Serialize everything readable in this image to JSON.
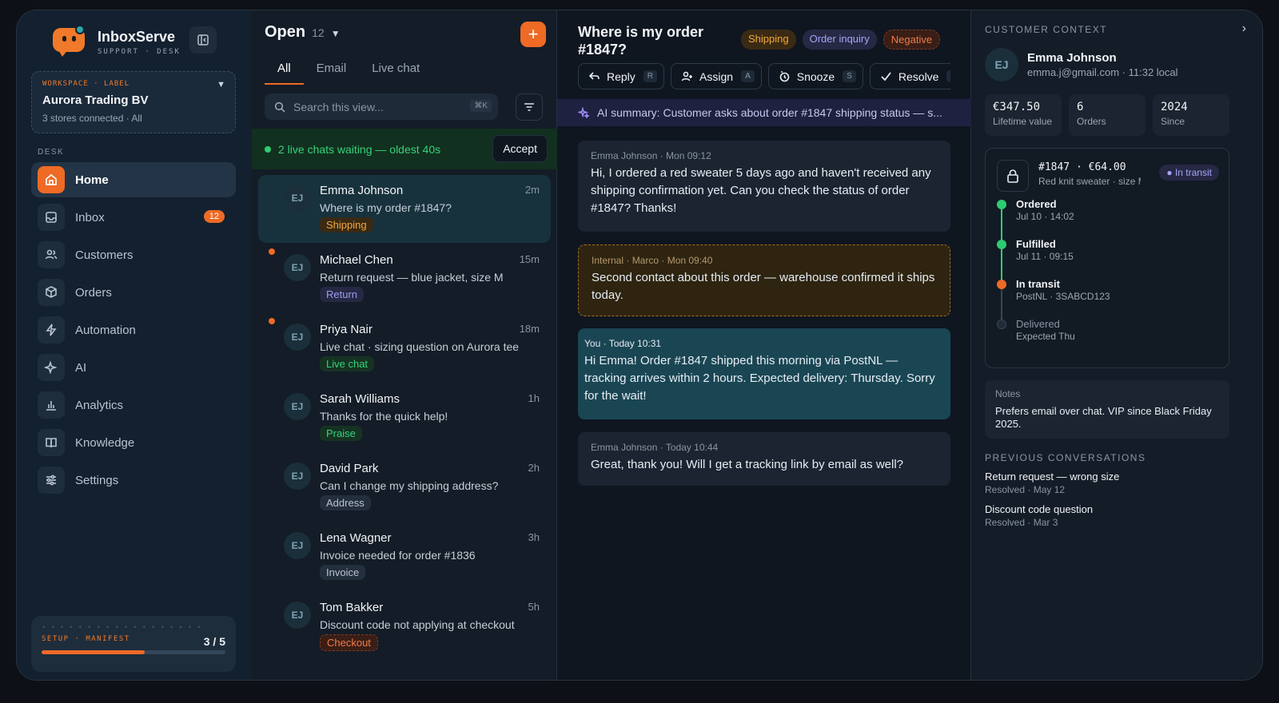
{
  "brand": {
    "name": "InboxServe",
    "sub": "SUPPORT · DESK"
  },
  "workspace": {
    "label": "WORKSPACE · LABEL",
    "name": "Aurora Trading BV",
    "sub": "3 stores connected · All"
  },
  "nav": {
    "section_label": "DESK",
    "items": [
      {
        "label": "Home",
        "icon": "home-icon"
      },
      {
        "label": "Inbox",
        "icon": "inbox-icon",
        "badge": "12"
      },
      {
        "label": "Customers",
        "icon": "users-icon"
      },
      {
        "label": "Orders",
        "icon": "box-icon"
      },
      {
        "label": "Automation",
        "icon": "bolt-icon"
      },
      {
        "label": "AI",
        "icon": "sparkle-icon"
      },
      {
        "label": "Analytics",
        "icon": "bar-chart-icon"
      },
      {
        "label": "Knowledge",
        "icon": "book-icon"
      },
      {
        "label": "Settings",
        "icon": "sliders-icon"
      }
    ]
  },
  "setup": {
    "label": "SETUP · MANIFEST",
    "count": "3 / 5",
    "progress": 0.56
  },
  "list": {
    "title": "Open",
    "count": "12",
    "tabs": [
      "All",
      "Email",
      "Live chat"
    ],
    "search_placeholder": "Search this view...",
    "search_shortcut": "⌘K",
    "banner": {
      "text": "2 live chats waiting — oldest 40s",
      "accept": "Accept"
    },
    "conversations": [
      {
        "initials": "EJ",
        "name": "Emma Johnson",
        "time": "2m",
        "snippet": "Where is my order #1847?",
        "tag": "Shipping"
      },
      {
        "initials": "EJ",
        "name": "Michael Chen",
        "time": "15m",
        "snippet": "Return request — blue jacket, size M",
        "tag": "Return"
      },
      {
        "initials": "EJ",
        "name": "Priya Nair",
        "time": "18m",
        "snippet": "Live chat · sizing question on Aurora tee",
        "tag": "Live chat"
      },
      {
        "initials": "EJ",
        "name": "Sarah Williams",
        "time": "1h",
        "snippet": "Thanks for the quick help!",
        "tag": "Praise"
      },
      {
        "initials": "EJ",
        "name": "David Park",
        "time": "2h",
        "snippet": "Can I change my shipping address?",
        "tag": "Address"
      },
      {
        "initials": "EJ",
        "name": "Lena Wagner",
        "time": "3h",
        "snippet": "Invoice needed for order #1836",
        "tag": "Invoice"
      },
      {
        "initials": "EJ",
        "name": "Tom Bakker",
        "time": "5h",
        "snippet": "Discount code not applying at checkout",
        "tag": "Checkout"
      }
    ]
  },
  "conversation": {
    "title": "Where is my order #1847?",
    "tags": [
      "Shipping",
      "Order inquiry",
      "Negative"
    ],
    "actions": [
      {
        "label": "Reply",
        "key": "R",
        "icon": "reply-icon"
      },
      {
        "label": "Assign",
        "key": "A",
        "icon": "assign-user-icon"
      },
      {
        "label": "Snooze",
        "key": "S",
        "icon": "snooze-icon"
      },
      {
        "label": "Resolve",
        "key": "E",
        "icon": "check-icon"
      }
    ],
    "ai_summary": "AI summary: Customer asks about order #1847 shipping status — s...",
    "messages": [
      {
        "meta": "Emma Johnson · Mon 09:12",
        "body": "Hi, I ordered a red sweater 5 days ago and haven't received any shipping confirmation yet. Can you check the status of order #1847? Thanks!"
      },
      {
        "meta": "Internal · Marco · Mon 09:40",
        "body": "Second contact about this order — warehouse confirmed it ships today."
      },
      {
        "meta": "You · Today 10:31",
        "body": "Hi Emma! Order #1847 shipped this morning via PostNL — tracking arrives within 2 hours. Expected delivery: Thursday. Sorry for the wait!"
      },
      {
        "meta": "Emma Johnson · Today 10:44",
        "body": "Great, thank you! Will I get a tracking link by email as well?"
      }
    ]
  },
  "customer": {
    "section_label": "CUSTOMER CONTEXT",
    "initials": "EJ",
    "name": "Emma Johnson",
    "sub": "emma.j@gmail.com · 11:32 local",
    "stats": [
      {
        "value": "€347.50",
        "label": "Lifetime value"
      },
      {
        "value": "6",
        "label": "Orders"
      },
      {
        "value": "2024",
        "label": "Since"
      }
    ],
    "order": {
      "id": "#1847 · €64.00",
      "desc": "Red knit sweater · size M",
      "status": "In transit",
      "timeline": [
        {
          "title": "Ordered",
          "sub": "Jul 10 · 14:02"
        },
        {
          "title": "Fulfilled",
          "sub": "Jul 11 · 09:15"
        },
        {
          "title": "In transit",
          "sub": "PostNL · 3SABCD123"
        },
        {
          "title": "Delivered",
          "sub": "Expected Thu"
        }
      ]
    },
    "notes": {
      "label": "Notes",
      "text": "Prefers email over chat. VIP since Black Friday 2025."
    },
    "previous_label": "PREVIOUS CONVERSATIONS",
    "previous": [
      {
        "title": "Return request — wrong size",
        "sub": "Resolved · May 12"
      },
      {
        "title": "Discount code question",
        "sub": "Resolved · Mar 3"
      }
    ]
  },
  "colors": {
    "accent": "#ee6a25",
    "success": "#2ecc71",
    "panel": "#131c27"
  }
}
